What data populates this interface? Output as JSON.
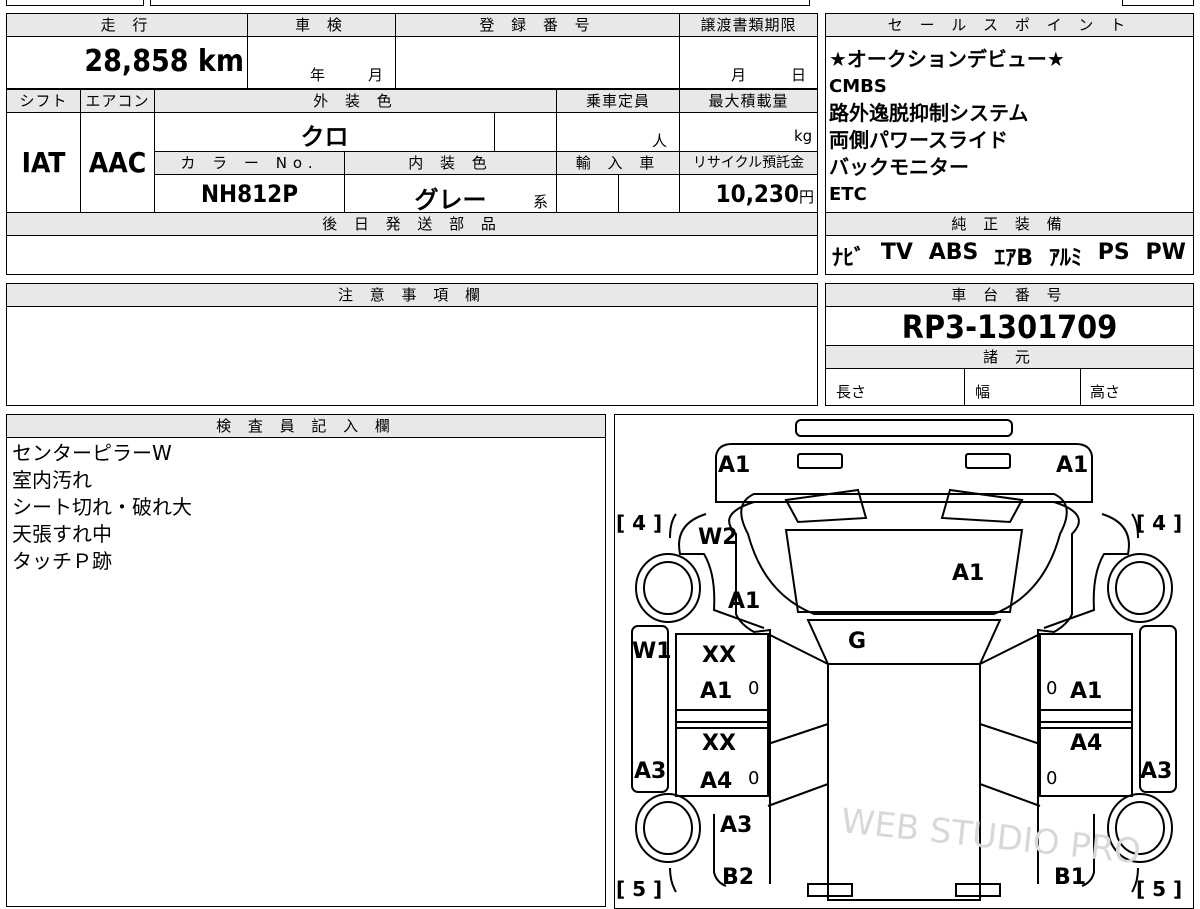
{
  "labels": {
    "mileage": "走 行",
    "inspection": "車 検",
    "registration": "登 録 番 号",
    "transfer_deadline": "譲渡書類期限",
    "sales_points": "セ ー ル ス ポ イ ン ト",
    "shift": "シフト",
    "aircon": "エアコン",
    "exterior_color": "外 装 色",
    "capacity": "乗車定員",
    "max_load": "最大積載量",
    "color_no": "カ ラ ー No.",
    "interior_color": "内 装 色",
    "import": "輸 入 車",
    "recycle": "リサイクル預託金",
    "later_parts": "後 日 発 送 部 品",
    "genuine_equipment": "純 正 装 備",
    "notes": "注 意 事 項 欄",
    "chassis_no": "車 台 番 号",
    "specs": "諸 元",
    "length": "長さ",
    "width": "幅",
    "height": "高さ",
    "inspector": "検 査 員 記 入 欄"
  },
  "vehicle": {
    "mileage": "28,858",
    "mileage_unit": "km",
    "inspection_year_unit": "年",
    "inspection_month_unit": "月",
    "transfer_month_unit": "月",
    "transfer_day_unit": "日",
    "shift": "IAT",
    "aircon": "AAC",
    "exterior_color": "クロ",
    "capacity_unit": "人",
    "load_unit": "kg",
    "color_no": "NH812P",
    "interior_color": "グレー",
    "interior_suffix": "系",
    "recycle_fee": "10,230",
    "recycle_unit": "円",
    "chassis_no": "RP3-1301709"
  },
  "sales_points": [
    "★オークションデビュー★",
    "CMBS",
    "路外逸脱抑制システム",
    "両側パワースライド",
    "バックモニター",
    "ETC"
  ],
  "equipment": [
    "ﾅﾋﾞ",
    "TV",
    "ABS",
    "ｴｱB",
    "ｱﾙﾐ",
    "PS",
    "PW"
  ],
  "inspector_notes": [
    "センターピラーW",
    "室内汚れ",
    "シート切れ・破れ大",
    "天張すれ中",
    "タッチＰ跡"
  ],
  "diagram": {
    "tire_front_left": "[ 4 ]",
    "tire_front_right": "[ 4 ]",
    "tire_rear_left": "[ 5 ]",
    "tire_rear_right": "[ 5 ]",
    "marks": {
      "bumper_front_left": "A1",
      "bumper_front_right": "A1",
      "fender_front_left": "W2",
      "hood": "A1",
      "fender_front_left_lower": "A1",
      "windshield": "G",
      "pillar_left": "W1",
      "door_front_left_a": "XX",
      "door_front_left_b": "A1",
      "door_front_left_zero": "0",
      "door_front_right_zero": "0",
      "door_front_right": "A1",
      "door_rear_left_a": "XX",
      "door_rear_left_b": "A4",
      "door_rear_left_zero": "0",
      "door_rear_right": "A4",
      "door_rear_right_zero": "0",
      "sill_left": "A3",
      "sill_right": "A3",
      "quarter_left": "A3",
      "bumper_rear_left": "B2",
      "bumper_rear_right": "B1"
    },
    "watermark": "WEB STUDIO PRO"
  }
}
